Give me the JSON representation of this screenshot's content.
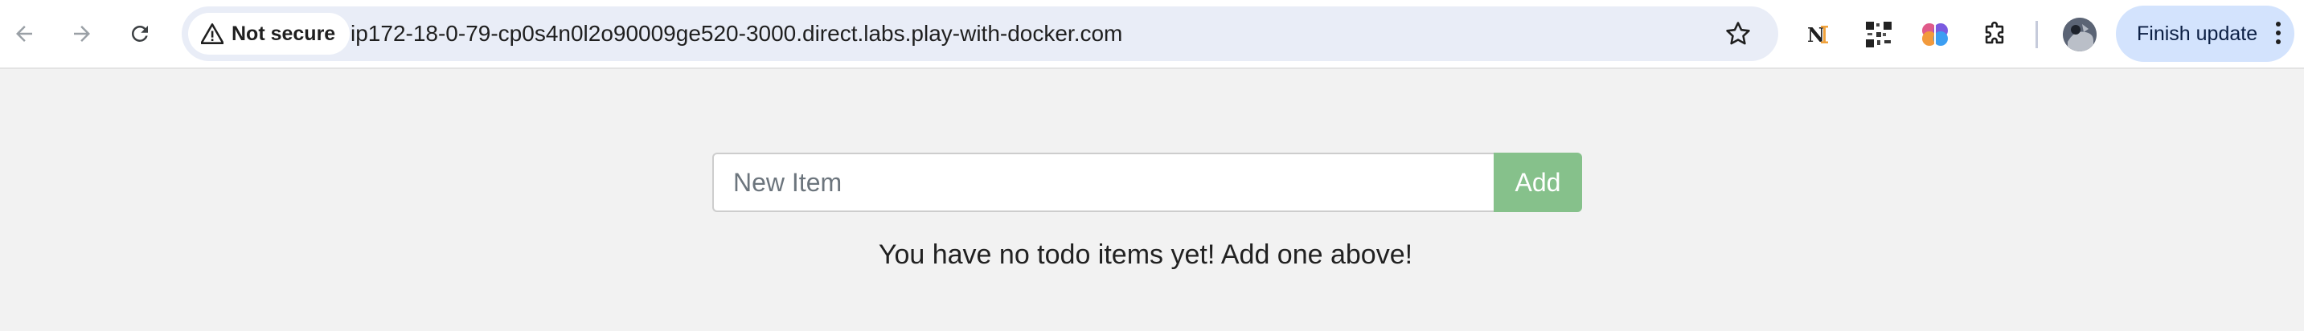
{
  "browser": {
    "security_label": "Not secure",
    "url": "ip172-18-0-79-cp0s4n0l2o90009ge520-3000.direct.labs.play-with-docker.com",
    "update_button_label": "Finish update",
    "icons": {
      "back": "arrow-left-icon",
      "forward": "arrow-right-icon",
      "reload": "reload-icon",
      "warning": "warning-triangle-icon",
      "bookmark": "star-icon",
      "extensions": "puzzle-icon",
      "menu": "kebab-menu-icon"
    },
    "extensions": [
      {
        "name": "notion-extension",
        "glyph": "N"
      },
      {
        "name": "qr-extension",
        "glyph": ""
      },
      {
        "name": "brain-extension",
        "glyph": ""
      }
    ]
  },
  "todo": {
    "input_placeholder": "New Item",
    "input_value": "",
    "add_label": "Add",
    "empty_message": "You have no todo items yet! Add one above!"
  },
  "colors": {
    "page_bg": "#f2f2f2",
    "omnibox_bg": "#e9edf7",
    "update_button_bg": "#d3e3fd",
    "add_button_bg": "#86c18b"
  }
}
